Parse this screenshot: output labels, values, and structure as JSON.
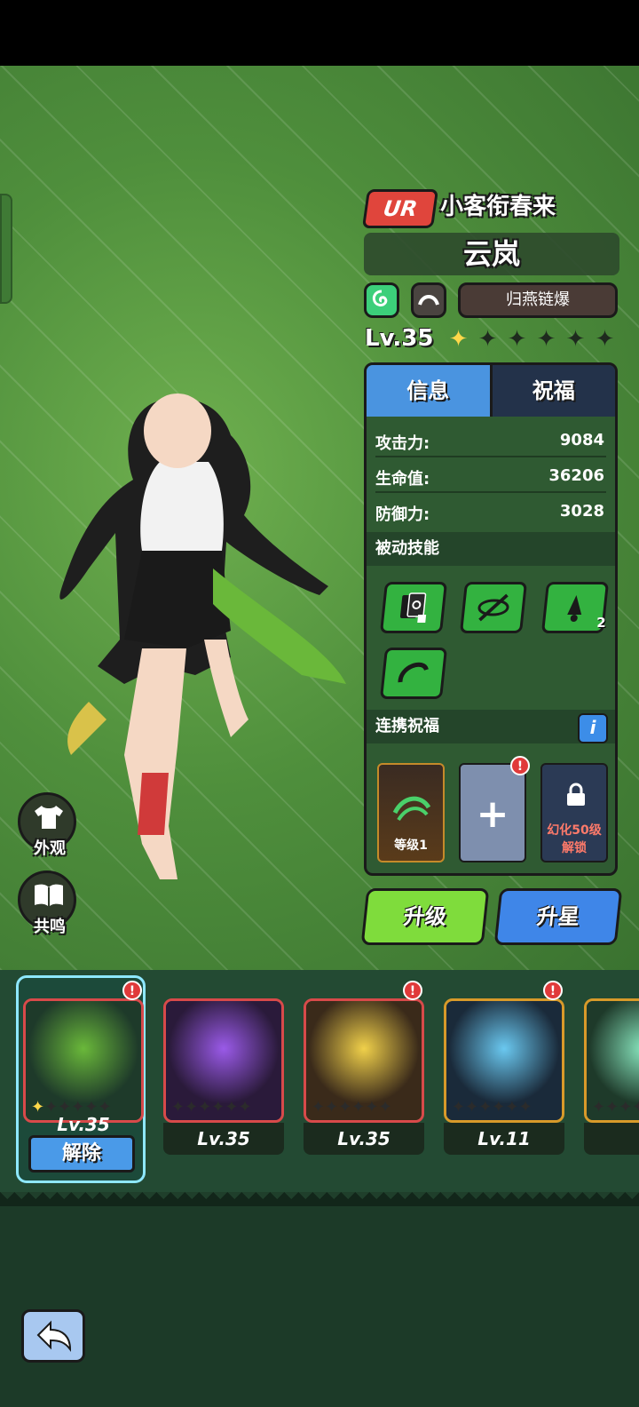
{
  "hero": {
    "rarity": "UR",
    "title": "小客衔春来",
    "name": "云岚",
    "skill_name": "归燕链爆",
    "level": "Lv.35",
    "stars_total": 6,
    "stars_lit": 1
  },
  "tabs": [
    {
      "label": "信息",
      "active": true
    },
    {
      "label": "祝福",
      "active": false
    }
  ],
  "stats": [
    {
      "label": "攻击力:",
      "value": "9084"
    },
    {
      "label": "生命值:",
      "value": "36206"
    },
    {
      "label": "防御力:",
      "value": "3028"
    }
  ],
  "passive": {
    "header": "被动技能",
    "skills": [
      {
        "icon": "cards-dice-icon",
        "count": ""
      },
      {
        "icon": "slash-orbit-icon",
        "count": ""
      },
      {
        "icon": "spirit-bell-icon",
        "count": "2"
      },
      {
        "icon": "horn-arc-icon",
        "count": ""
      }
    ]
  },
  "bless": {
    "header": "连携祝福",
    "info_label": "i",
    "slots": [
      {
        "label": "等级1",
        "state": "filled",
        "icon": "wind-swirl-icon"
      },
      {
        "label": "+",
        "state": "add",
        "badge": "!"
      },
      {
        "label": "幻化50级解锁",
        "line1": "幻化50级",
        "line2": "解锁",
        "state": "locked",
        "icon": "lock-icon"
      }
    ]
  },
  "actions": {
    "upgrade": "升级",
    "star_up": "升星"
  },
  "side_buttons": {
    "appearance": "外观",
    "resonance": "共鸣"
  },
  "roster": [
    {
      "level": "Lv.35",
      "stars_lit": 1,
      "selected": true,
      "badge": "!",
      "frame_color": "#d84a4a",
      "art": "green-bird"
    },
    {
      "level": "Lv.35",
      "stars_lit": 0,
      "selected": false,
      "badge": "",
      "frame_color": "#d84a4a",
      "art": "purple-beast"
    },
    {
      "level": "Lv.35",
      "stars_lit": 0,
      "selected": false,
      "badge": "!",
      "frame_color": "#d84a4a",
      "art": "golden-lightning"
    },
    {
      "level": "Lv.11",
      "stars_lit": 0,
      "selected": false,
      "badge": "!",
      "frame_color": "#d89a2a",
      "art": "ice-crystal"
    },
    {
      "level": "L",
      "stars_lit": 0,
      "selected": false,
      "badge": "",
      "frame_color": "#d89a2a",
      "art": "mint-dragon"
    }
  ],
  "release_label": "解除",
  "colors": {
    "accent_blue": "#4a94e0",
    "upgrade_green": "#7fdc3c",
    "rarity_red": "#e0453c",
    "panel_green": "#2f5a32"
  }
}
